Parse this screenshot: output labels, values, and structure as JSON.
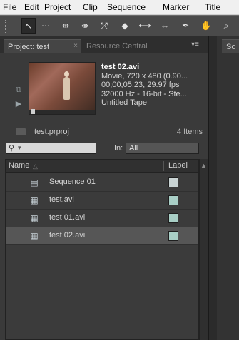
{
  "menubar": {
    "items": [
      "File",
      "Edit",
      "Project",
      "Clip",
      "Sequence",
      "Marker",
      "Title"
    ]
  },
  "toolbar": {
    "tools": [
      {
        "icon": "selection-arrow-icon",
        "glyph": "↖"
      },
      {
        "icon": "track-select-icon",
        "glyph": "⋯"
      },
      {
        "icon": "ripple-edit-icon",
        "glyph": "⇹"
      },
      {
        "icon": "rolling-edit-icon",
        "glyph": "⇼"
      },
      {
        "icon": "rate-stretch-icon",
        "glyph": "⤱"
      },
      {
        "icon": "razor-icon",
        "glyph": "◆"
      },
      {
        "icon": "slip-icon",
        "glyph": "⟷"
      },
      {
        "icon": "slide-icon",
        "glyph": "⇔"
      },
      {
        "icon": "pen-icon",
        "glyph": "✒"
      },
      {
        "icon": "hand-icon",
        "glyph": "✋"
      },
      {
        "icon": "zoom-icon",
        "glyph": "⌕"
      }
    ]
  },
  "project_panel": {
    "tab_label": "Project: test",
    "tab_close": "×",
    "resource_tab": "Resource Central",
    "clip_info": {
      "title": "test 02.avi",
      "line1": "Movie, 720 x 480 (0.90...",
      "line2": "00;00;05;23, 29.97 fps",
      "line3": "32000 Hz - 16-bit - Ste...",
      "line4": "Untitled Tape"
    },
    "project_file": "test.prproj",
    "item_count": "4 Items",
    "search_placeholder": "",
    "in_label": "In:",
    "in_value": "All",
    "columns": {
      "name": "Name",
      "label": "Label"
    },
    "items": [
      {
        "name": "Sequence 01",
        "icon": "sequence-icon",
        "label_color": "#c9d3d3"
      },
      {
        "name": "test.avi",
        "icon": "video-clip-icon",
        "label_color": "#a9cfc6"
      },
      {
        "name": "test 01.avi",
        "icon": "video-clip-icon",
        "label_color": "#a9cfc6"
      },
      {
        "name": "test 02.avi",
        "icon": "video-clip-icon",
        "label_color": "#a9cfc6",
        "selected": true
      }
    ]
  },
  "right_panel": {
    "tab_label": "Sc"
  }
}
